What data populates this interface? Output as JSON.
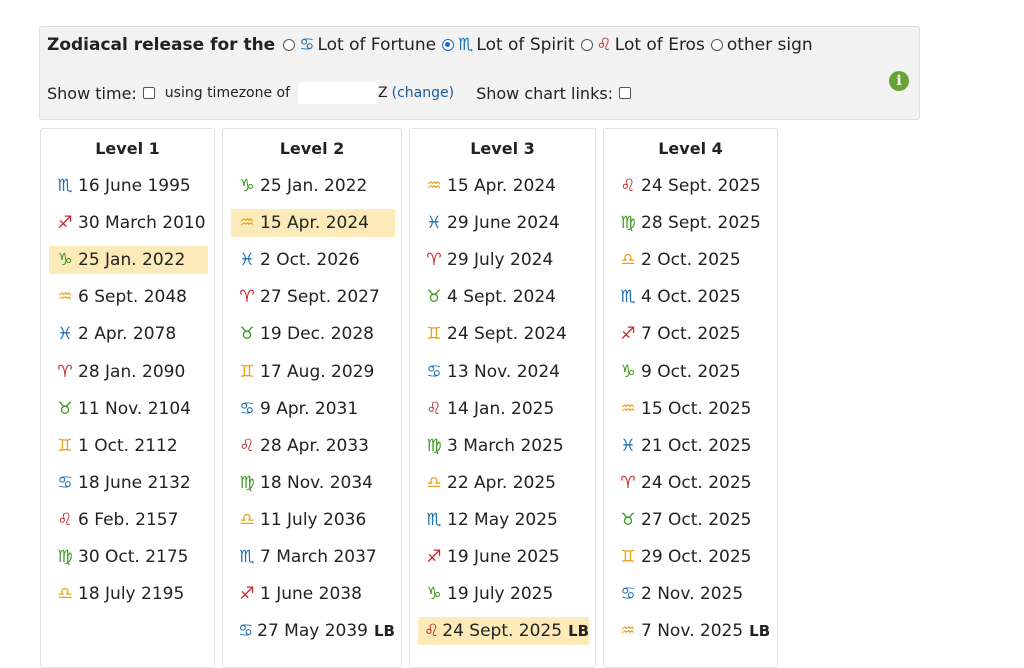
{
  "header": {
    "label": "Zodiacal release for the",
    "options": [
      {
        "symbol": "♋",
        "color": "#1a6fb3",
        "text": "Lot of Fortune",
        "checked": false
      },
      {
        "symbol": "♏",
        "color": "#1a6fb3",
        "text": "Lot of Spirit",
        "checked": true
      },
      {
        "symbol": "♌",
        "color": "#c62828",
        "text": "Lot of Eros",
        "checked": false
      },
      {
        "symbol": "",
        "color": "#222",
        "text": "other sign",
        "checked": false
      }
    ],
    "show_time_label": "Show time:",
    "timezone_label": "using timezone of",
    "timezone_fragment": "Z",
    "change_link": "(change)",
    "chart_links_label": "Show chart links:",
    "info_icon": "i"
  },
  "colors": {
    "fire": "#c62828",
    "earth": "#3a9a1f",
    "air": "#e8a21a",
    "water": "#1a6fb3",
    "highlight": "#fcebb8"
  },
  "levels": [
    {
      "title": "Level 1",
      "rows": [
        {
          "sym": "♏",
          "el": "water",
          "text": "16 June 1995"
        },
        {
          "sym": "♐",
          "el": "fire",
          "text": "30 March 2010"
        },
        {
          "sym": "♑",
          "el": "earth",
          "text": "25 Jan. 2022",
          "hl": true
        },
        {
          "sym": "♒",
          "el": "air",
          "text": "6 Sept. 2048"
        },
        {
          "sym": "♓",
          "el": "water",
          "text": "2 Apr. 2078"
        },
        {
          "sym": "♈",
          "el": "fire",
          "text": "28 Jan. 2090"
        },
        {
          "sym": "♉",
          "el": "earth",
          "text": "11 Nov. 2104"
        },
        {
          "sym": "♊",
          "el": "air",
          "text": "1 Oct. 2112"
        },
        {
          "sym": "♋",
          "el": "water",
          "text": "18 June 2132"
        },
        {
          "sym": "♌",
          "el": "fire",
          "text": "6 Feb. 2157"
        },
        {
          "sym": "♍",
          "el": "earth",
          "text": "30 Oct. 2175"
        },
        {
          "sym": "♎",
          "el": "air",
          "text": "18 July 2195"
        }
      ]
    },
    {
      "title": "Level 2",
      "rows": [
        {
          "sym": "♑",
          "el": "earth",
          "text": "25 Jan. 2022"
        },
        {
          "sym": "♒",
          "el": "air",
          "text": "15 Apr. 2024",
          "hl": true
        },
        {
          "sym": "♓",
          "el": "water",
          "text": "2 Oct. 2026"
        },
        {
          "sym": "♈",
          "el": "fire",
          "text": "27 Sept. 2027"
        },
        {
          "sym": "♉",
          "el": "earth",
          "text": "19 Dec. 2028"
        },
        {
          "sym": "♊",
          "el": "air",
          "text": "17 Aug. 2029"
        },
        {
          "sym": "♋",
          "el": "water",
          "text": "9 Apr. 2031"
        },
        {
          "sym": "♌",
          "el": "fire",
          "text": "28 Apr. 2033"
        },
        {
          "sym": "♍",
          "el": "earth",
          "text": "18 Nov. 2034"
        },
        {
          "sym": "♎",
          "el": "air",
          "text": "11 July 2036"
        },
        {
          "sym": "♏",
          "el": "water",
          "text": "7 March 2037"
        },
        {
          "sym": "♐",
          "el": "fire",
          "text": "1 June 2038"
        },
        {
          "sym": "♋",
          "el": "water",
          "text": "27 May 2039",
          "lb": "LB"
        }
      ]
    },
    {
      "title": "Level 3",
      "rows": [
        {
          "sym": "♒",
          "el": "air",
          "text": "15 Apr. 2024"
        },
        {
          "sym": "♓",
          "el": "water",
          "text": "29 June 2024"
        },
        {
          "sym": "♈",
          "el": "fire",
          "text": "29 July 2024"
        },
        {
          "sym": "♉",
          "el": "earth",
          "text": "4 Sept. 2024"
        },
        {
          "sym": "♊",
          "el": "air",
          "text": "24 Sept. 2024"
        },
        {
          "sym": "♋",
          "el": "water",
          "text": "13 Nov. 2024"
        },
        {
          "sym": "♌",
          "el": "fire",
          "text": "14 Jan. 2025"
        },
        {
          "sym": "♍",
          "el": "earth",
          "text": "3 March 2025"
        },
        {
          "sym": "♎",
          "el": "air",
          "text": "22 Apr. 2025"
        },
        {
          "sym": "♏",
          "el": "water",
          "text": "12 May 2025"
        },
        {
          "sym": "♐",
          "el": "fire",
          "text": "19 June 2025"
        },
        {
          "sym": "♑",
          "el": "earth",
          "text": "19 July 2025"
        },
        {
          "sym": "♌",
          "el": "fire",
          "text": "24 Sept. 2025",
          "lb": "LB",
          "hl": true
        }
      ]
    },
    {
      "title": "Level 4",
      "rows": [
        {
          "sym": "♌",
          "el": "fire",
          "text": "24 Sept. 2025"
        },
        {
          "sym": "♍",
          "el": "earth",
          "text": "28 Sept. 2025"
        },
        {
          "sym": "♎",
          "el": "air",
          "text": "2 Oct. 2025"
        },
        {
          "sym": "♏",
          "el": "water",
          "text": "4 Oct. 2025"
        },
        {
          "sym": "♐",
          "el": "fire",
          "text": "7 Oct. 2025"
        },
        {
          "sym": "♑",
          "el": "earth",
          "text": "9 Oct. 2025"
        },
        {
          "sym": "♒",
          "el": "air",
          "text": "15 Oct. 2025"
        },
        {
          "sym": "♓",
          "el": "water",
          "text": "21 Oct. 2025"
        },
        {
          "sym": "♈",
          "el": "fire",
          "text": "24 Oct. 2025"
        },
        {
          "sym": "♉",
          "el": "earth",
          "text": "27 Oct. 2025"
        },
        {
          "sym": "♊",
          "el": "air",
          "text": "29 Oct. 2025"
        },
        {
          "sym": "♋",
          "el": "water",
          "text": "2 Nov. 2025"
        },
        {
          "sym": "♒",
          "el": "air",
          "text": "7 Nov. 2025",
          "lb": "LB"
        }
      ]
    }
  ]
}
